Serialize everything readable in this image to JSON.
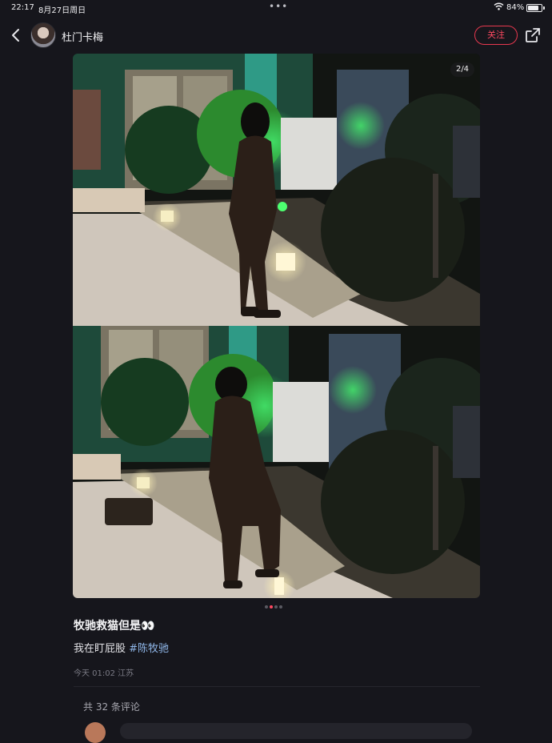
{
  "status_bar": {
    "time": "22:17",
    "date": "8月27日周日",
    "battery_text": "84%",
    "battery_level": 0.84
  },
  "header": {
    "author_name": "杜门卡梅",
    "follow_label": "关注"
  },
  "carousel": {
    "counter": "2/4",
    "current_index": 2,
    "total": 4
  },
  "post": {
    "title": "牧驰救猫但是👀",
    "body_text": "我在盯屁股 ",
    "hashtag": "#陈牧驰",
    "meta": "今天 01:02 江苏"
  },
  "comments": {
    "count_label": "共 32 条评论"
  },
  "icons": {
    "back": "chevron-left-icon",
    "share": "share-icon",
    "wifi": "wifi-icon",
    "battery": "battery-icon"
  },
  "colors": {
    "background": "#16161c",
    "accent": "#ff4961",
    "hashtag": "#8fb6e8"
  }
}
